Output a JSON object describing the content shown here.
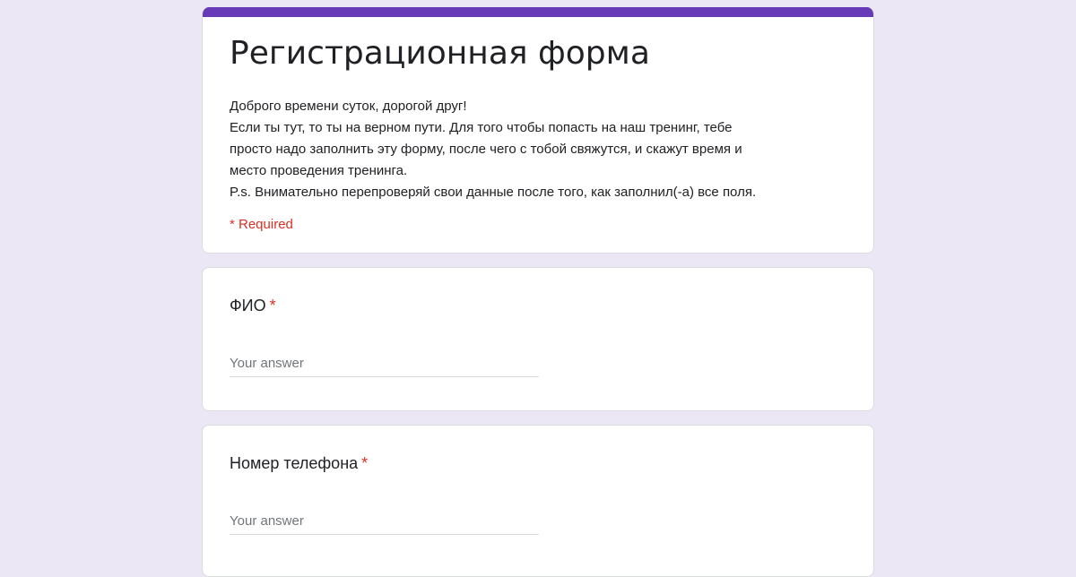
{
  "form": {
    "title": "Регистрационная форма",
    "description": [
      "Доброго времени суток, дорогой друг!",
      "Если ты тут, то ты на верном пути. Для того чтобы попасть на наш тренинг, тебе",
      "просто надо заполнить эту форму, после чего с тобой свяжутся, и скажут время и",
      "место проведения тренинга.",
      "P.s. Внимательно перепроверяй свои данные после того, как заполнил(-а) все поля."
    ],
    "required_note": "* Required",
    "accent_color": "#673ab7",
    "background_color": "#ebe7f5"
  },
  "questions": [
    {
      "label": "ФИО",
      "required_marker": "*",
      "placeholder": "Your answer",
      "value": ""
    },
    {
      "label": "Номер телефона",
      "required_marker": "*",
      "placeholder": "Your answer",
      "value": ""
    }
  ]
}
